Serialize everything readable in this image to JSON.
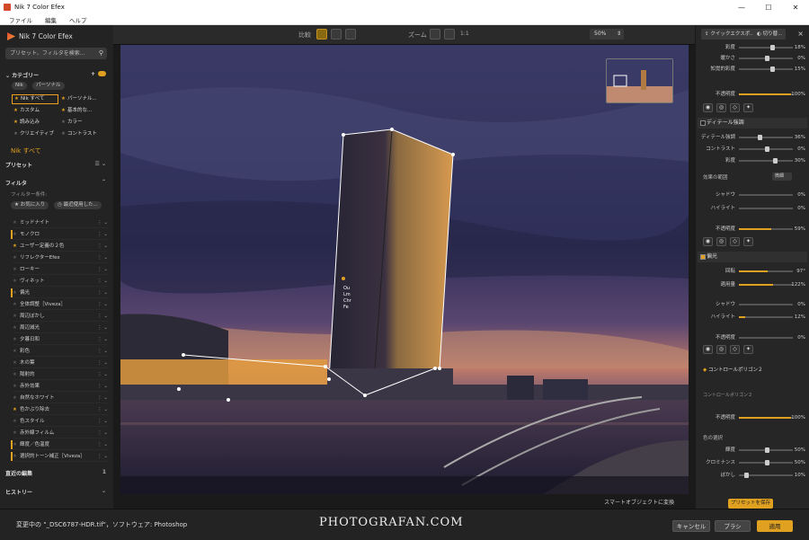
{
  "window": {
    "title": "Nik 7 Color Efex",
    "minimize": "—",
    "maximize": "☐",
    "close": "✕"
  },
  "menu": [
    "ファイル",
    "編集",
    "ヘルプ"
  ],
  "left": {
    "logo": "Nik 7 Color Efex",
    "search_placeholder": "プリセット、フィルタを検索...",
    "category_title": "カテゴリー",
    "tabs": [
      "Nik",
      "パーソナル"
    ],
    "categories": [
      {
        "label": "Nik すべて",
        "selected": true
      },
      {
        "label": "パーソナル...",
        "selected": false
      },
      {
        "label": "カスタム",
        "selected": false
      },
      {
        "label": "基本的な...",
        "selected": false
      },
      {
        "label": "読み込み",
        "selected": false
      },
      {
        "label": "カラー",
        "selected": false
      },
      {
        "label": "クリエイティブ",
        "selected": false
      },
      {
        "label": "コントラスト",
        "selected": false
      }
    ],
    "current_category": "Nik すべて",
    "presets_title": "プリセット",
    "filters_title": "フィルタ",
    "filter_condition": "フィルター条件:",
    "filter_chips": [
      "お気に入り",
      "最近使用した..."
    ],
    "filters": [
      {
        "label": "ミッドナイト",
        "fav": false,
        "bar": false
      },
      {
        "label": "モノクロ",
        "fav": false,
        "bar": true
      },
      {
        "label": "ユーザー定義の２色",
        "fav": true,
        "bar": false
      },
      {
        "label": "リフレクターEfex",
        "fav": false,
        "bar": false
      },
      {
        "label": "ローキー",
        "fav": false,
        "bar": false
      },
      {
        "label": "ヴィネット",
        "fav": false,
        "bar": false
      },
      {
        "label": "偏光",
        "fav": false,
        "bar": true
      },
      {
        "label": "全体調整［Viveza］",
        "fav": false,
        "bar": false
      },
      {
        "label": "周辺ぼかし",
        "fav": false,
        "bar": false
      },
      {
        "label": "周辺減光",
        "fav": false,
        "bar": false
      },
      {
        "label": "夕暮日和",
        "fav": false,
        "bar": false
      },
      {
        "label": "彩色",
        "fav": false,
        "bar": false
      },
      {
        "label": "木の葉",
        "fav": false,
        "bar": false
      },
      {
        "label": "陽射的",
        "fav": false,
        "bar": false
      },
      {
        "label": "赤外効果",
        "fav": false,
        "bar": false
      },
      {
        "label": "自然なホワイト",
        "fav": false,
        "bar": false
      },
      {
        "label": "色かぶり除去",
        "fav": true,
        "bar": false
      },
      {
        "label": "色スタイル",
        "fav": false,
        "bar": false
      },
      {
        "label": "赤外線フィルム",
        "fav": false,
        "bar": false
      },
      {
        "label": "輝度／色温度",
        "fav": false,
        "bar": true
      },
      {
        "label": "選択的トーン補正［Viveza］",
        "fav": false,
        "bar": true
      }
    ],
    "history_edit": "直近の編集",
    "history_count": "1",
    "history": "ヒストリー"
  },
  "toolbar": {
    "compare": "比較",
    "zoom": "ズーム",
    "zoom_one": "1:1",
    "zoom_value": "50%"
  },
  "canvas": {
    "control_labels": [
      "Ou",
      "Lm",
      "Chr",
      "Fe"
    ]
  },
  "smart": "スマートオブジェクトに変換",
  "right": {
    "quick_export": "クイックエクスポ...",
    "crop": "切り替...",
    "sliders_top": [
      {
        "label": "彩度",
        "value": "18%",
        "pos": 0.6
      },
      {
        "label": "暖かさ",
        "value": "0%",
        "pos": 0.5
      },
      {
        "label": "知覚的彩度",
        "value": "15%",
        "pos": 0.6
      }
    ],
    "opacity_label": "不透明度",
    "opacity_top": "100%",
    "detail_title": "ディテール強調",
    "detail_sliders": [
      {
        "label": "ディテール強調",
        "value": "36%",
        "pos": 0.36
      },
      {
        "label": "コントラスト",
        "value": "0%",
        "pos": 0.5
      },
      {
        "label": "彩度",
        "value": "30%",
        "pos": 0.65
      }
    ],
    "effect_range_label": "効果の範囲",
    "effect_range_value": "微細",
    "shadow_label": "シャドウ",
    "shadow_value": "0%",
    "highlight_label": "ハイライト",
    "highlight_value": "0%",
    "opacity_mid": "59%",
    "polar_title": "偏光",
    "rotation_label": "回転",
    "rotation_value": "97°",
    "amount_label": "適用量",
    "amount_value": "122%",
    "shadow2_value": "0%",
    "highlight2_value": "12%",
    "opacity_polar": "0%",
    "control_polygon": "コントロールポリゴン２",
    "control_polygon_sub": "コントロールポリゴン２",
    "opacity_bottom": "100%",
    "color_select": "色の選択",
    "bottom_sliders": [
      {
        "label": "輝度",
        "value": "50%",
        "pos": 0.5
      },
      {
        "label": "クロミナンス",
        "value": "50%",
        "pos": 0.5
      },
      {
        "label": "ぼかし",
        "value": "10%",
        "pos": 0.1
      }
    ],
    "save_preset": "プリセットを保存"
  },
  "status": {
    "message": "変更中の \"_DSC6787-HDR.tif\"，ソフトウェア: Photoshop",
    "brand": "PHOTOGRAFAN.COM",
    "cancel": "キャンセル",
    "brush": "ブラシ",
    "apply": "適用"
  }
}
